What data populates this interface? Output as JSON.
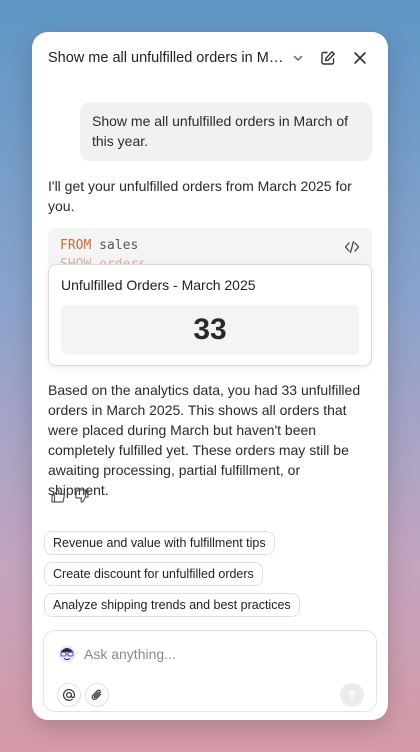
{
  "header": {
    "title": "Show me all unfulfilled orders in Mar...",
    "icons": [
      "chevron-down-icon",
      "edit-icon",
      "close-icon"
    ]
  },
  "conversation": {
    "user_message": "Show me all unfulfilled orders in March of this year.",
    "ai_intro": "I'll get your unfulfilled orders from March 2025 for you.",
    "code": {
      "line1_keyword": "FROM",
      "line1_rest": " sales",
      "line2": "  SHOW orders"
    },
    "result_card": {
      "title": "Unfulfilled Orders - March 2025",
      "value": "33"
    },
    "ai_summary": "Based on the analytics data, you had 33 unfulfilled orders in March 2025. This shows all orders that were placed during March but haven't been completely fulfilled yet. These orders may still be awaiting processing, partial fulfillment, or shipment."
  },
  "suggestions": [
    "Revenue and value with fulfillment tips",
    "Create discount for unfulfilled orders",
    "Analyze shipping trends and best practices"
  ],
  "composer": {
    "placeholder": "Ask anything...",
    "icons": [
      "mention-icon",
      "attach-icon",
      "send-icon"
    ]
  },
  "colors": {
    "accent_keyword": "#c96a3a",
    "card_border": "#ddd7ea"
  }
}
